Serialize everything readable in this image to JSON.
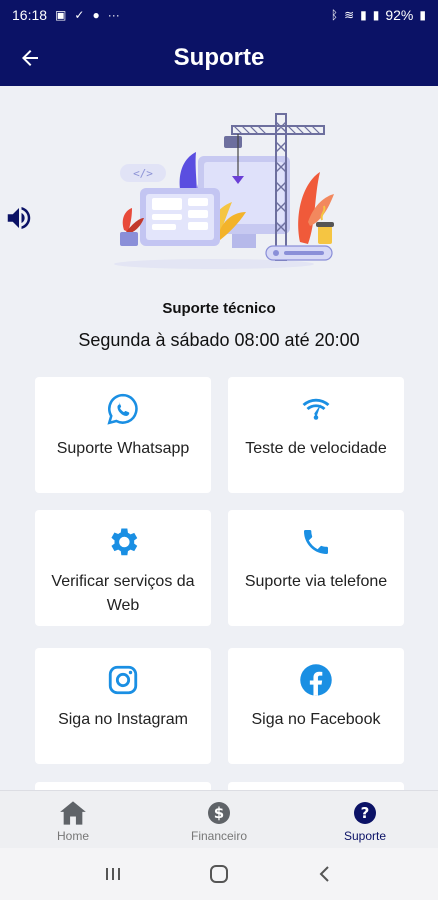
{
  "status_bar": {
    "time": "16:18",
    "battery": "92%"
  },
  "header": {
    "title": "Suporte"
  },
  "support": {
    "title": "Suporte técnico",
    "hours": "Segunda à sábado 08:00 até 20:00"
  },
  "cards": [
    {
      "label": "Suporte Whatsapp",
      "icon": "whatsapp-icon"
    },
    {
      "label": "Teste de velocidade",
      "icon": "speedtest-icon"
    },
    {
      "label": "Verificar serviços da Web",
      "icon": "gear-icon"
    },
    {
      "label": "Suporte via telefone",
      "icon": "phone-icon"
    },
    {
      "label": "Siga no Instagram",
      "icon": "instagram-icon"
    },
    {
      "label": "Siga no Facebook",
      "icon": "facebook-icon"
    }
  ],
  "bottom_nav": [
    {
      "label": "Home",
      "icon": "home-icon",
      "active": false
    },
    {
      "label": "Financeiro",
      "icon": "dollar-icon",
      "active": false
    },
    {
      "label": "Suporte",
      "icon": "help-icon",
      "active": true
    }
  ],
  "colors": {
    "primary": "#0b1266",
    "accent": "#1a8fe3"
  }
}
